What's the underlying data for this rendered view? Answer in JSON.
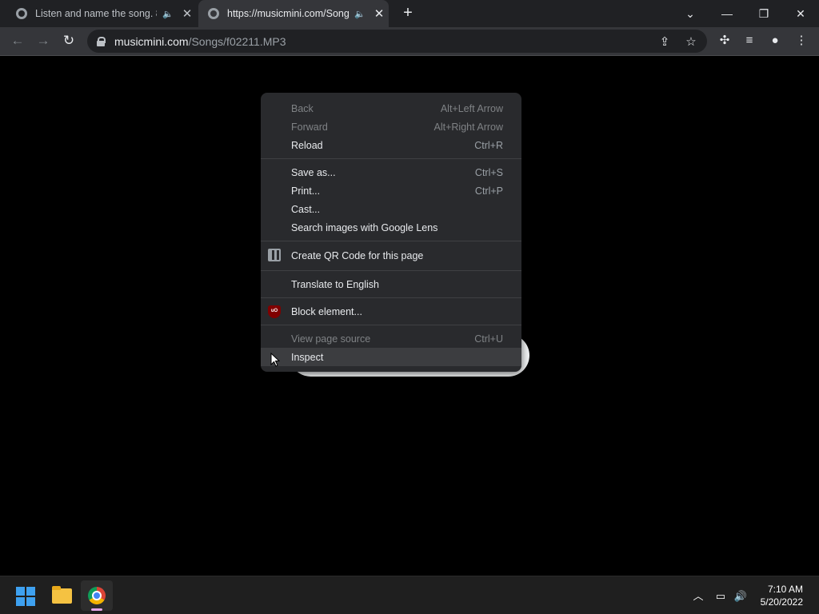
{
  "browser": {
    "tabs": [
      {
        "title": "Listen and name the song. 8",
        "active": false,
        "icon": "globe-icon"
      },
      {
        "title": "https://musicmini.com/Song",
        "active": true,
        "icon": "globe-icon"
      }
    ],
    "new_tab": "+",
    "window_controls": {
      "tab_search": "⌄",
      "minimize": "—",
      "restore": "❐",
      "close": "✕"
    },
    "nav": {
      "back": "←",
      "forward": "→",
      "reload": "↻"
    },
    "address": {
      "host": "musicmini.com",
      "path": "/Songs/f02211.MP3"
    },
    "toolbar_icons": [
      "share-icon",
      "star-icon",
      "extensions-icon",
      "media-icon",
      "profile-icon",
      "menu-icon"
    ]
  },
  "context_menu": {
    "groups": [
      [
        {
          "label": "Back",
          "shortcut": "Alt+Left Arrow",
          "disabled": true
        },
        {
          "label": "Forward",
          "shortcut": "Alt+Right Arrow",
          "disabled": true
        },
        {
          "label": "Reload",
          "shortcut": "Ctrl+R",
          "disabled": false
        }
      ],
      [
        {
          "label": "Save as...",
          "shortcut": "Ctrl+S",
          "disabled": false
        },
        {
          "label": "Print...",
          "shortcut": "Ctrl+P",
          "disabled": false
        },
        {
          "label": "Cast...",
          "shortcut": "",
          "disabled": false
        },
        {
          "label": "Search images with Google Lens",
          "shortcut": "",
          "disabled": false
        }
      ],
      [
        {
          "label": "Create QR Code for this page",
          "shortcut": "",
          "disabled": false,
          "icon": "qr-code-icon"
        }
      ],
      [
        {
          "label": "Translate to English",
          "shortcut": "",
          "disabled": false
        }
      ],
      [
        {
          "label": "Block element...",
          "shortcut": "",
          "disabled": false,
          "icon": "ublock-icon"
        }
      ],
      [
        {
          "label": "View page source",
          "shortcut": "Ctrl+U",
          "disabled": true
        },
        {
          "label": "Inspect",
          "shortcut": "",
          "disabled": false,
          "highlight": true
        }
      ]
    ]
  },
  "taskbar": {
    "apps": [
      "start-icon",
      "file-explorer-icon",
      "chrome-icon"
    ],
    "tray_icons": [
      "chevron-up-icon",
      "network-icon",
      "volume-icon"
    ],
    "time": "7:10 AM",
    "date": "5/20/2022"
  },
  "colors": {
    "accent": "#3ea1f0",
    "menu_bg": "#292a2d",
    "tabstrip": "#202124",
    "toolbar": "#35363a"
  }
}
